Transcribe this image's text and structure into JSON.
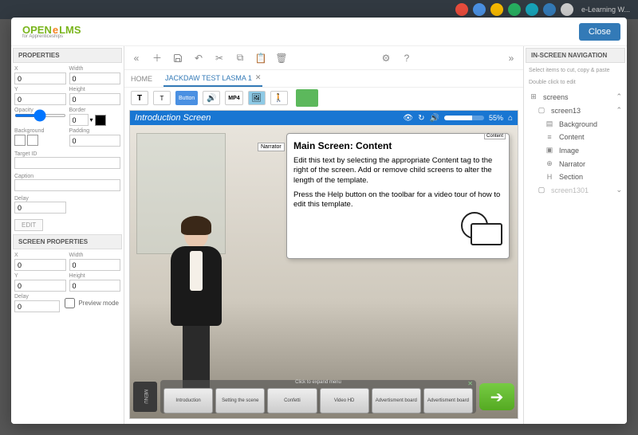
{
  "header": {
    "logo_open": "OPEN",
    "logo_e": "e",
    "logo_lms": "LMS",
    "logo_sub": "for Apprenticeships",
    "close": "Close",
    "top_label": "e-Learning W..."
  },
  "top_circles": [
    "#e74c3c",
    "#4a90e2",
    "#f5b800",
    "#27ae60",
    "#17a2b8",
    "#337ab7"
  ],
  "properties": {
    "title": "PROPERTIES",
    "x_label": "X",
    "x": "0",
    "w_label": "Width",
    "w": "0",
    "y_label": "Y",
    "y": "0",
    "h_label": "Height",
    "h": "0",
    "opacity_label": "Opacity",
    "border_label": "Border",
    "border": "0",
    "background_label": "Background",
    "padding_label": "Padding",
    "padding": "0",
    "target_label": "Target ID",
    "caption_label": "Caption",
    "delay_label": "Delay",
    "delay": "0",
    "edit": "EDIT"
  },
  "screen_props": {
    "title": "SCREEN PROPERTIES",
    "x_label": "X",
    "x": "0",
    "w_label": "Width",
    "w": "0",
    "y_label": "Y",
    "y": "0",
    "h_label": "Height",
    "h": "0",
    "delay_label": "Delay",
    "delay": "0",
    "preview": "Preview mode"
  },
  "breadcrumb": {
    "home": "HOME",
    "current": "JACKDAW TEST LASMA 1"
  },
  "elements": {
    "t1": "T",
    "t2": "T",
    "btn": "Button",
    "mp4": "MP4"
  },
  "stage": {
    "title": "Introduction Screen",
    "percent": "55%",
    "narrator_tag": "Narrator",
    "content_tag": "Content",
    "content_heading": "Main Screen: Content",
    "content_p1": "Edit this text by selecting the appropriate Content tag to the right of the screen. Add or remove child screens to alter the length of the template.",
    "content_p2": "Press the Help button on the toolbar for a video tour of how to edit this template.",
    "menu": "MENU",
    "expand": "Click to expand menu",
    "nav": [
      "Introduction",
      "Setting the scene",
      "Confetti",
      "Video HD",
      "Advertisment board",
      "Advertisment board"
    ]
  },
  "nav_panel": {
    "title": "IN-SCREEN NAVIGATION",
    "hint1": "Select items to cut, copy & paste",
    "hint2": "Double click to edit",
    "tree": [
      {
        "icon": "⊞",
        "label": "screens",
        "chev": "⌃",
        "indent": 0
      },
      {
        "icon": "▢",
        "label": "screen13",
        "chev": "⌃",
        "indent": 1
      },
      {
        "icon": "▤",
        "label": "Background",
        "indent": 2
      },
      {
        "icon": "≡",
        "label": "Content",
        "indent": 2
      },
      {
        "icon": "▣",
        "label": "Image",
        "indent": 2
      },
      {
        "icon": "⊕",
        "label": "Narrator",
        "indent": 2
      },
      {
        "icon": "H",
        "label": "Section",
        "indent": 2
      },
      {
        "icon": "▢",
        "label": "screen1301",
        "chev": "⌄",
        "indent": 1,
        "muted": true
      }
    ]
  }
}
